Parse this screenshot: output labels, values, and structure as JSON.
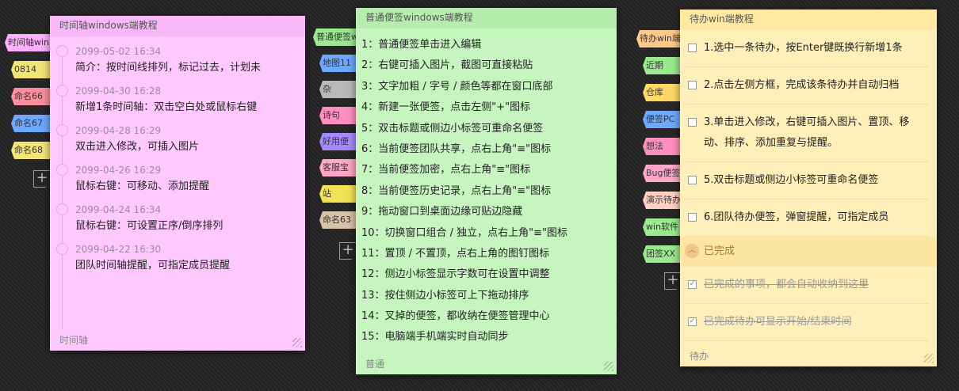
{
  "timeline_tabs": [
    {
      "label": "时间轴win",
      "color": "#ffb0ff"
    },
    {
      "label": "0814",
      "color": "#f2e477"
    },
    {
      "label": "命名66",
      "color": "#ff8f9e"
    },
    {
      "label": "命名67",
      "color": "#6ea8ff"
    },
    {
      "label": "命名68",
      "color": "#f2e477"
    }
  ],
  "normal_tabs": [
    {
      "label": "普通便签w",
      "color": "#9cea8f"
    },
    {
      "label": "地图11",
      "color": "#6ea8ff"
    },
    {
      "label": "杂",
      "color": "#b9b9b9"
    },
    {
      "label": "诗句",
      "color": "#ff8fbf"
    },
    {
      "label": "好用便",
      "color": "#a58aff"
    },
    {
      "label": "客服宝",
      "color": "#ffa7c8"
    },
    {
      "label": "站",
      "color": "#f2e255"
    },
    {
      "label": "命名63",
      "color": "#d8c2a8"
    }
  ],
  "todo_tabs": [
    {
      "label": "待办win端",
      "color": "#ffc98a"
    },
    {
      "label": "近期",
      "color": "#9cea8f"
    },
    {
      "label": "仓库",
      "color": "#ffd966"
    },
    {
      "label": "便签PC",
      "color": "#6ea8ff"
    },
    {
      "label": "想法",
      "color": "#ff8fbf"
    },
    {
      "label": "Bug便签",
      "color": "#ffa7c8"
    },
    {
      "label": "演示待办",
      "color": "#ffd1c2"
    },
    {
      "label": "win软件",
      "color": "#9cea8f"
    },
    {
      "label": "团签XX",
      "color": "#9cea8f"
    }
  ],
  "timeline": {
    "title": "时间轴windows端教程",
    "footer": "时间轴",
    "items": [
      {
        "date": "2099-05-02 16:34",
        "text": "简介：按时间线排列，标记过去，计划未"
      },
      {
        "date": "2099-04-30 16:28",
        "text": "新增1条时间轴：双击空白处或鼠标右键"
      },
      {
        "date": "2099-04-28 16:29",
        "text": "双击进入修改，可插入图片"
      },
      {
        "date": "2099-04-26 16:29",
        "text": "鼠标右键：可移动、添加提醒"
      },
      {
        "date": "2099-04-24 16:34",
        "text": "鼠标右键：可设置正序/倒序排列"
      },
      {
        "date": "2099-04-22 16:30",
        "text": "团队时间轴提醒，可指定成员提醒"
      }
    ]
  },
  "normal": {
    "title": "普通便签windows端教程",
    "footer": "普通",
    "lines": [
      "1：普通便签单击进入编辑",
      "2：右键可插入图片，截图可直接粘贴",
      "3：文字加粗 / 字号 / 颜色等都在窗口底部",
      "4：新建一张便签，点击左侧\"+\"图标",
      "5：双击标题或侧边小标签可重命名便签",
      "6：当前便签团队共享，点右上角\"≡\"图标",
      "7：当前便签加密，点右上角\"≡\"图标",
      "8：当前便签历史记录，点右上角\"≡\"图标",
      "9：拖动窗口到桌面边缘可贴边隐藏",
      "10：切换窗口组合 / 独立，点右上角\"≡\"图标",
      "11：置顶 / 不置顶，点右上角的图钉图标",
      "12：侧边小标签显示字数可在设置中调整",
      "13：按住侧边小标签可上下拖动排序",
      "14：叉掉的便签，都收纳在便签管理中心",
      "15：电脑端手机端实时自动同步"
    ]
  },
  "todo": {
    "title": "待办win端教程",
    "footer": "待办",
    "items": [
      "1.选中一条待办，按Enter键既换行新增1条",
      "2.点击左侧方框，完成该条待办并自动归档",
      "3.单击进入修改，右键可插入图片、置顶、移动、排序、添加重复与提醒。",
      "5.双击标题或侧边小标签可重命名便签",
      "6.团队待办便签，弹窗提醒，可指定成员"
    ],
    "done_label": "已完成",
    "done_items": [
      "已完成的事项，都会自动收纳到这里",
      "已完成待办可显示开始/结束时间"
    ]
  },
  "icons": {
    "add": "plus-icon",
    "check": "check-icon",
    "chevron": "chevron-up-icon",
    "grip": "resize-grip-icon"
  }
}
